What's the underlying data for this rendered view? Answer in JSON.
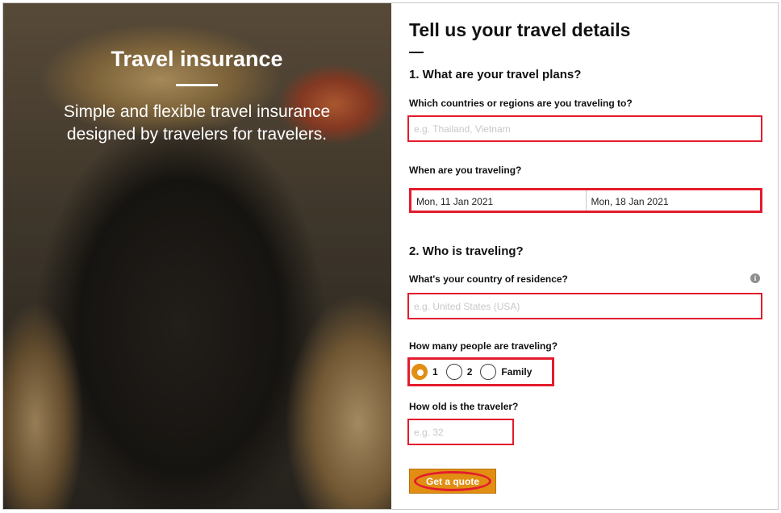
{
  "hero": {
    "title": "Travel insurance",
    "subtitle": "Simple and flexible travel insurance designed by travelers for travelers."
  },
  "form": {
    "title": "Tell us your travel details",
    "section1": "1. What are your travel plans?",
    "countries_label": "Which countries or regions are you traveling to?",
    "countries_placeholder": "e.g. Thailand, Vietnam",
    "when_label": "When are you traveling?",
    "start_date": "Mon, 11 Jan 2021",
    "end_date": "Mon, 18 Jan 2021",
    "section2": "2. Who is traveling?",
    "residence_label": "What's your country of residence?",
    "residence_placeholder": "e.g. United States (USA)",
    "info_icon": "i",
    "people_label": "How many people are traveling?",
    "people_options": [
      "1",
      "2",
      "Family"
    ],
    "people_selected": "1",
    "age_label": "How old is the traveler?",
    "age_placeholder": "e.g. 32",
    "quote_button": "Get a quote"
  },
  "colors": {
    "accent": "#e18e12",
    "highlight": "#e31c2d"
  }
}
